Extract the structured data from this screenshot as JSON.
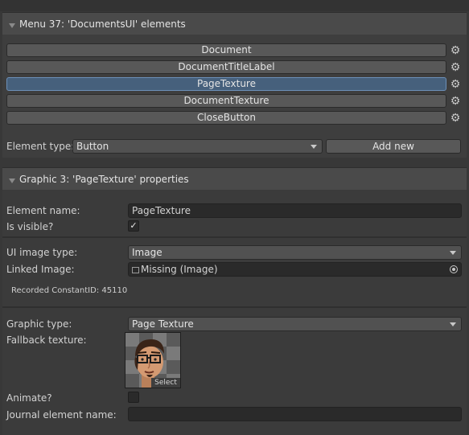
{
  "menu_header": {
    "title": "Menu 37: 'DocumentsUI' elements"
  },
  "elements": [
    {
      "label": "Document",
      "selected": false
    },
    {
      "label": "DocumentTitleLabel",
      "selected": false
    },
    {
      "label": "PageTexture",
      "selected": true
    },
    {
      "label": "DocumentTexture",
      "selected": false
    },
    {
      "label": "CloseButton",
      "selected": false
    }
  ],
  "element_type": {
    "label": "Element type:",
    "value": "Button"
  },
  "add_new_label": "Add new",
  "graphic_header": {
    "title": "Graphic 3: 'PageTexture' properties"
  },
  "properties": {
    "element_name_label": "Element name:",
    "element_name_value": "PageTexture",
    "is_visible_label": "Is visible?",
    "is_visible_checked": true,
    "ui_image_type_label": "UI image type:",
    "ui_image_type_value": "Image",
    "linked_image_label": "Linked Image:",
    "linked_image_value": "Missing (Image)",
    "recorded_constant_id": "Recorded ConstantID: 45110",
    "graphic_type_label": "Graphic type:",
    "graphic_type_value": "Page Texture",
    "fallback_texture_label": "Fallback texture:",
    "select_label": "Select",
    "animate_label": "Animate?",
    "animate_checked": false,
    "journal_element_name_label": "Journal element name:",
    "journal_element_name_value": ""
  },
  "icons": {
    "gear": "gear-icon",
    "foldout": "foldout-triangle-icon",
    "checkmark": "checkmark-icon",
    "image_missing": "image-icon",
    "object_picker": "object-picker-icon"
  },
  "colors": {
    "background": "#383838",
    "header": "#4a4a4a",
    "selected": "#46607c",
    "field": "#2a2a2a"
  }
}
